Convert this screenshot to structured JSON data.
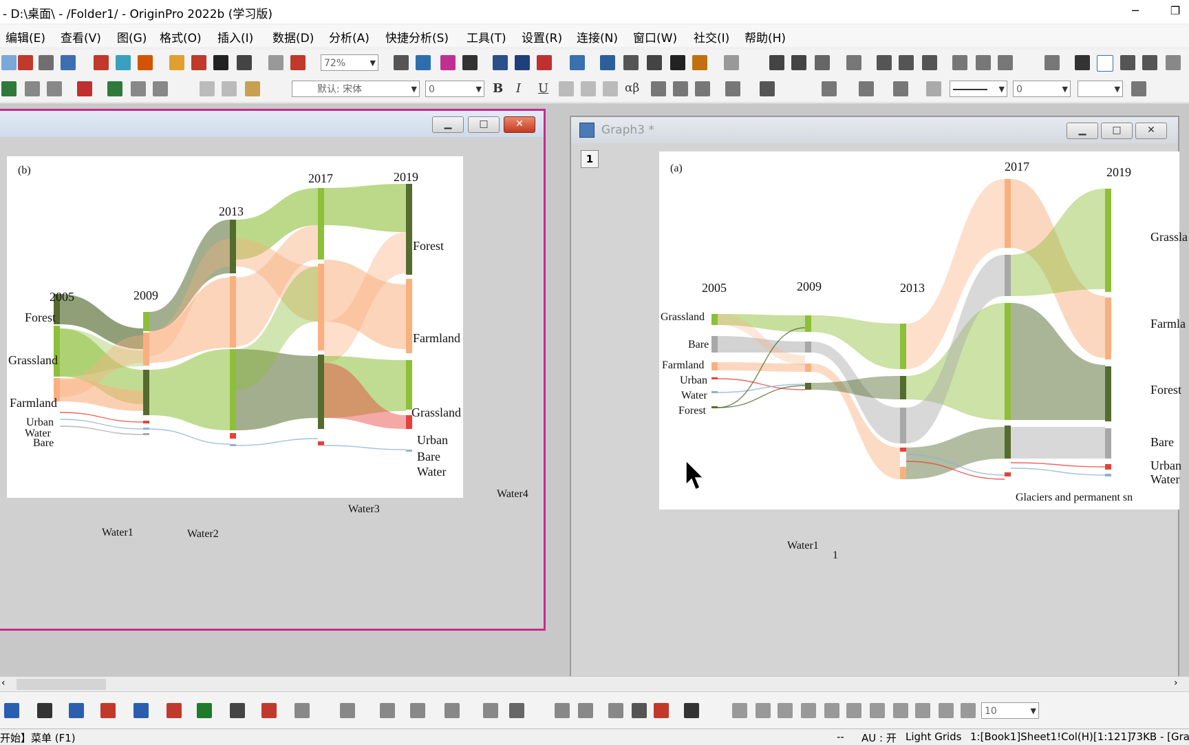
{
  "app": {
    "title": "- D:\\桌面\\ - /Folder1/ - OriginPro 2022b (学习版)"
  },
  "menu": [
    "编辑(E)",
    "查看(V)",
    "图(G)",
    "格式(O)",
    "插入(I)",
    "数据(D)",
    "分析(A)",
    "快捷分析(S)",
    "工具(T)",
    "设置(R)",
    "连接(N)",
    "窗口(W)",
    "社交(I)",
    "帮助(H)"
  ],
  "toolbar": {
    "zoom": "72%",
    "font_name": "默认: 宋体",
    "font_size": "0",
    "line_width": "0",
    "label_bold": "B",
    "label_italic": "I",
    "label_underline": "U",
    "label_alphabeta": "αβ"
  },
  "graph_b": {
    "panel_label": "(b)",
    "years": [
      "2005",
      "2009",
      "2013",
      "2017",
      "2019"
    ],
    "left_labels": [
      "Forest",
      "Grassland",
      "Farmland",
      "Urban",
      "Water",
      "Bare"
    ],
    "right_labels": [
      "Forest",
      "Farmland",
      "Grassland",
      "Urban",
      "Bare",
      "Water"
    ],
    "extra": [
      "Water1",
      "Water2",
      "Water3",
      "Water4"
    ]
  },
  "graph_a": {
    "window_title": "Graph3 *",
    "layer": "1",
    "panel_label": "(a)",
    "years": [
      "2005",
      "2009",
      "2013",
      "2017",
      "2019"
    ],
    "left_labels": [
      "Grassland",
      "Bare",
      "Farmland",
      "Urban",
      "Water",
      "Forest"
    ],
    "right_labels": [
      "Grassla",
      "Farmla",
      "Forest",
      "Bare",
      "Urban",
      "Water",
      "Glaciers and permanent sn"
    ],
    "extra": [
      "Water1",
      "1"
    ]
  },
  "bottom": {
    "size_field": "10"
  },
  "status": {
    "menu": "开始】菜单 (F1)",
    "dash": "--",
    "au": "AU : 开",
    "grids": "Light Grids",
    "col": "1:[Book1]Sheet1!Col(H)[1:121]",
    "size": "73KB - [Gra"
  },
  "colors": {
    "forest": "#556b2f",
    "grassland": "#8dbf3a",
    "farmland": "#f9b07f",
    "urban": "#e8403a",
    "water": "#8fb0d8",
    "bare": "#a8a8a8"
  }
}
